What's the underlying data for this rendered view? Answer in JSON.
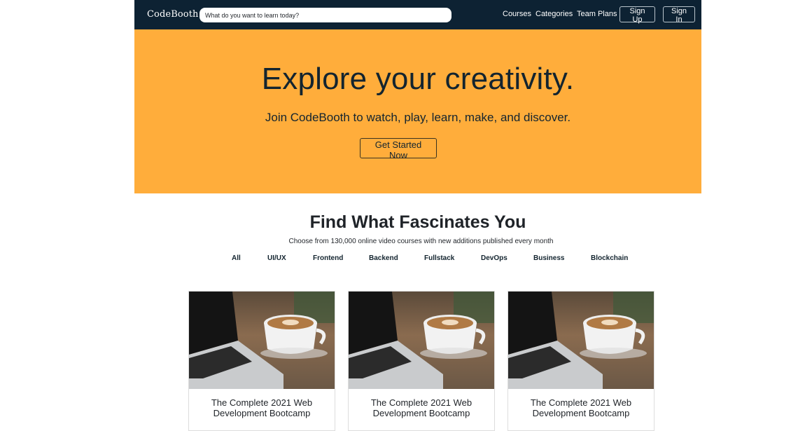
{
  "nav": {
    "brand": "CodeBooth",
    "search_placeholder": "What do you want to learn today?",
    "links": [
      "Courses",
      "Categories",
      "Team Plans"
    ],
    "sign_up": "Sign Up",
    "sign_in": "Sign In"
  },
  "hero": {
    "title": "Explore your creativity.",
    "subtitle": "Join CodeBooth to watch, play, learn, make, and discover.",
    "cta": "Get Started Now"
  },
  "section": {
    "title": "Find What Fascinates You",
    "subtitle": "Choose from 130,000 online video courses with new additions published every month",
    "tabs": [
      "All",
      "UI/UX",
      "Frontend",
      "Backend",
      "Fullstack",
      "DevOps",
      "Business",
      "Blockchain"
    ]
  },
  "courses": [
    {
      "title": "The Complete 2021 Web Development Bootcamp"
    },
    {
      "title": "The Complete 2021 Web Development Bootcamp"
    },
    {
      "title": "The Complete 2021 Web Development Bootcamp"
    }
  ],
  "colors": {
    "nav_bg": "#0d2233",
    "hero_bg": "#ffad3b",
    "text_dark": "#13242f"
  },
  "icons": {
    "course_image": "laptop-and-coffee-photo"
  }
}
